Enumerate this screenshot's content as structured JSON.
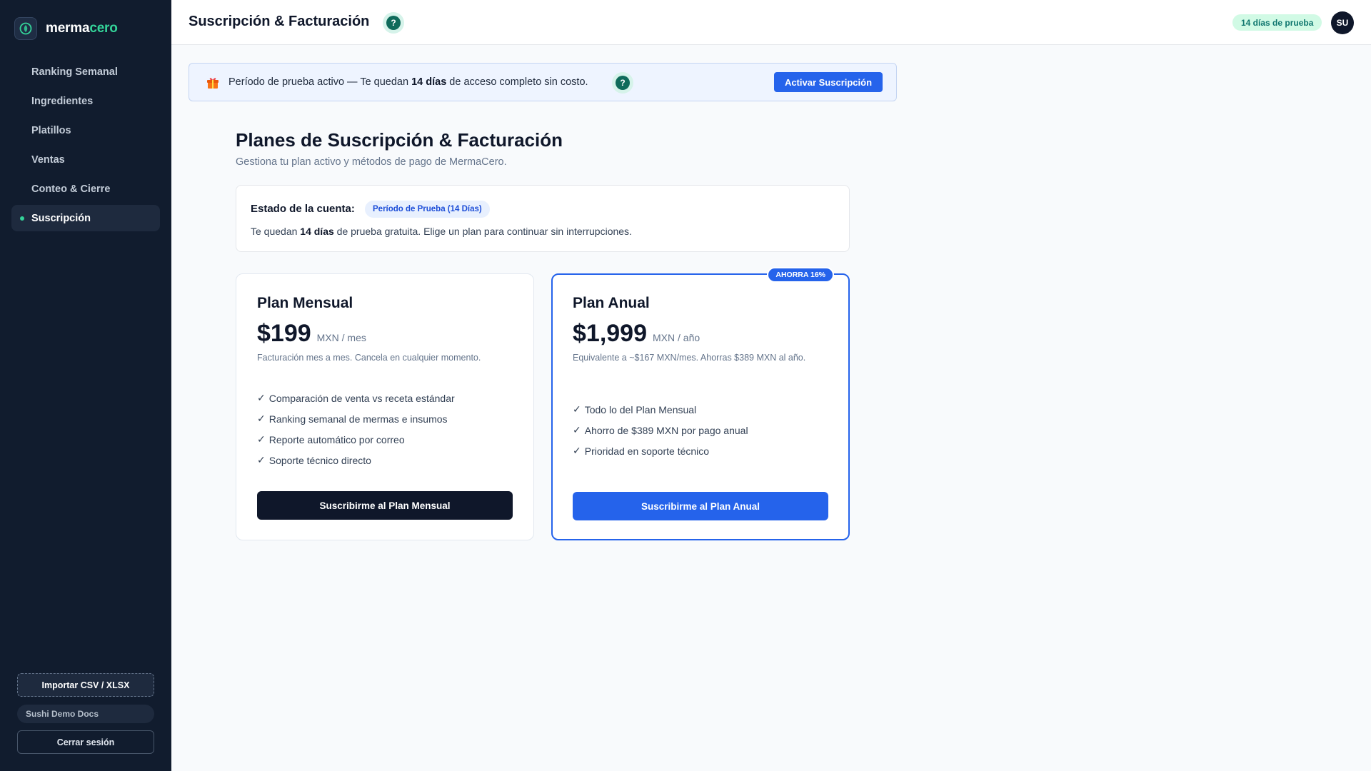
{
  "sidebar": {
    "brand": {
      "part1": "merma",
      "part2": "cero"
    },
    "nav": [
      {
        "label": "Ranking Semanal",
        "active": false
      },
      {
        "label": "Ingredientes",
        "active": false
      },
      {
        "label": "Platillos",
        "active": false
      },
      {
        "label": "Ventas",
        "active": false
      },
      {
        "label": "Conteo & Cierre",
        "active": false
      },
      {
        "label": "Suscripción",
        "active": true
      }
    ],
    "import_label": "Importar CSV / XLSX",
    "demo_docs_label": "Sushi Demo Docs",
    "logout_label": "Cerrar sesión"
  },
  "topbar": {
    "title": "Suscripción & Facturación",
    "help": "?",
    "trial_pill": "14 días de prueba",
    "avatar_initials": "SU"
  },
  "banner": {
    "text_before": "Período de prueba activo — Te quedan ",
    "text_bold": "14 días",
    "text_after": " de acceso completo sin costo.",
    "help": "?",
    "activate_label": "Activar Suscripción"
  },
  "main": {
    "title": "Planes de Suscripción & Facturación",
    "subtitle": "Gestiona tu plan activo y métodos de pago de MermaCero."
  },
  "status": {
    "label": "Estado de la cuenta:",
    "badge": "Período de Prueba (14 Días)",
    "desc_before": "Te quedan ",
    "desc_bold": "14 días",
    "desc_after": " de prueba gratuita. Elige un plan para continuar sin interrupciones."
  },
  "plans": {
    "monthly": {
      "name": "Plan Mensual",
      "price": "$199",
      "period": "MXN / mes",
      "note": "Facturación mes a mes. Cancela en cualquier momento.",
      "features": [
        "Comparación de venta vs receta estándar",
        "Ranking semanal de mermas e insumos",
        "Reporte automático por correo",
        "Soporte técnico directo"
      ],
      "button": "Suscribirme al Plan Mensual"
    },
    "annual": {
      "badge": "AHORRA 16%",
      "name": "Plan Anual",
      "price": "$1,999",
      "period": "MXN / año",
      "note": "Equivalente a ~$167 MXN/mes. Ahorras $389 MXN al año.",
      "features": [
        "Todo lo del Plan Mensual",
        "Ahorro de $389 MXN por pago anual",
        "Prioridad en soporte técnico"
      ],
      "button": "Suscribirme al Plan Anual"
    },
    "check_glyph": "✓"
  },
  "colors": {
    "sidebar_bg": "#111c2e",
    "accent_green": "#34d399",
    "primary_blue": "#2563eb",
    "dark_button": "#0f172a"
  }
}
